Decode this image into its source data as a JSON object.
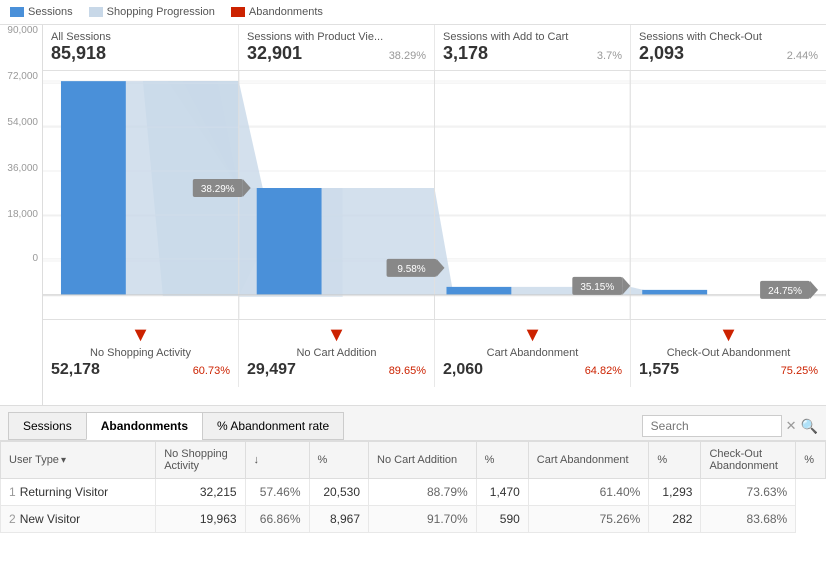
{
  "legend": {
    "items": [
      {
        "label": "Sessions",
        "type": "sessions"
      },
      {
        "label": "Shopping Progression",
        "type": "shopping"
      },
      {
        "label": "Abandonments",
        "type": "abandonments"
      }
    ]
  },
  "columns": [
    {
      "title": "All Sessions",
      "value": "85,918",
      "pct": "",
      "bar_height_pct": 100,
      "funnel_end_pct": 38,
      "pct_label": "38.29%",
      "drop_label": "No Shopping Activity",
      "drop_value": "52,178",
      "drop_pct": "60.73%"
    },
    {
      "title": "Sessions with Product Vie...",
      "value": "32,901",
      "pct": "38.29%",
      "bar_height_pct": 38,
      "funnel_end_pct": 9.5,
      "pct_label": "9.58%",
      "drop_label": "No Cart Addition",
      "drop_value": "29,497",
      "drop_pct": "89.65%"
    },
    {
      "title": "Sessions with Add to Cart",
      "value": "3,178",
      "pct": "3.7%",
      "bar_height_pct": 3.7,
      "funnel_end_pct": 2.4,
      "pct_label": "35.15%",
      "drop_label": "Cart Abandonment",
      "drop_value": "2,060",
      "drop_pct": "64.82%"
    },
    {
      "title": "Sessions with Check-Out",
      "value": "2,093",
      "pct": "2.44%",
      "bar_height_pct": 2.4,
      "funnel_end_pct": 0,
      "pct_label": "24.75%",
      "drop_label": "Check-Out Abandonment",
      "drop_value": "1,575",
      "drop_pct": "75.25%"
    }
  ],
  "y_axis": {
    "labels": [
      "90,000",
      "72,000",
      "54,000",
      "36,000",
      "18,000",
      "0"
    ]
  },
  "tabs": {
    "items": [
      "Sessions",
      "Abandonments",
      "% Abandonment rate"
    ],
    "active": 1
  },
  "search": {
    "placeholder": "Search"
  },
  "table": {
    "headers": [
      "User Type",
      "No Shopping Activity",
      "↓",
      "%",
      "No Cart Addition",
      "%",
      "Cart Abandonment",
      "%",
      "Check-Out Abandonment",
      "%"
    ],
    "rows": [
      {
        "num": "1",
        "user_type": "Returning Visitor",
        "no_shopping": "32,215",
        "no_shopping_pct": "57.46%",
        "no_cart": "20,530",
        "no_cart_pct": "88.79%",
        "cart_abandon": "1,470",
        "cart_abandon_pct": "61.40%",
        "checkout_abandon": "1,293",
        "checkout_abandon_pct": "73.63%"
      },
      {
        "num": "2",
        "user_type": "New Visitor",
        "no_shopping": "19,963",
        "no_shopping_pct": "66.86%",
        "no_cart": "8,967",
        "no_cart_pct": "91.70%",
        "cart_abandon": "590",
        "cart_abandon_pct": "75.26%",
        "checkout_abandon": "282",
        "checkout_abandon_pct": "83.68%"
      }
    ]
  }
}
